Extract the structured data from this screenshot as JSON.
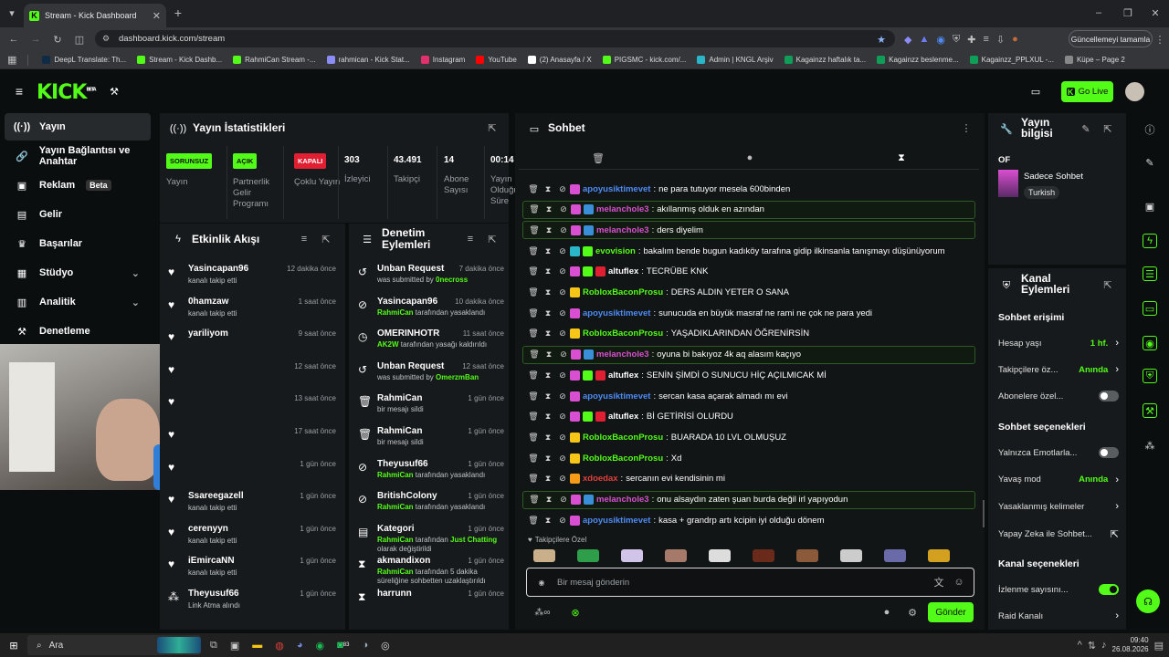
{
  "browser": {
    "tab_title": "Stream - Kick Dashboard",
    "url": "dashboard.kick.com/stream",
    "update_label": "Güncellemeyi tamamla",
    "bookmarks": [
      "DeepL Translate: Th...",
      "Stream - Kick Dashb...",
      "RahmiCan Stream -...",
      "rahmican - Kick Stat...",
      "Instagram",
      "YouTube",
      "(2) Anasayfa / X",
      "PIGSMC - kick.com/...",
      "Admin | KNGL Arşiv",
      "Kagainzz haftalık ta...",
      "Kagainzz beslenme...",
      "Kagainzz_PPLXUL -...",
      "Küpe – Page 2"
    ]
  },
  "app": {
    "logo": "KICK",
    "beta_sup": "BETA",
    "go_live": "Go Live"
  },
  "sidebar": {
    "items": [
      {
        "label": "Yayın",
        "icon": "broadcast-icon"
      },
      {
        "label": "Yayın Bağlantısı ve Anahtar",
        "icon": "link-icon"
      },
      {
        "label": "Reklam",
        "icon": "ad-icon",
        "badge": "Beta"
      },
      {
        "label": "Gelir",
        "icon": "revenue-icon"
      },
      {
        "label": "Başarılar",
        "icon": "trophy-icon"
      },
      {
        "label": "Stüdyo",
        "icon": "studio-icon"
      },
      {
        "label": "Analitik",
        "icon": "analytics-icon"
      },
      {
        "label": "Denetleme",
        "icon": "moderation-icon"
      }
    ]
  },
  "stats": {
    "title": "Yayın İstatistikleri",
    "badges": [
      {
        "text": "SORUNSUZ",
        "label": "Yayın",
        "color": "#53fc18"
      },
      {
        "text": "AÇIK",
        "label": "Partnerlik Gelir Programı",
        "color": "#53fc18"
      },
      {
        "text": "KAPALI",
        "label": "Çoklu Yayın",
        "color": "#e01f32"
      }
    ],
    "numbers": [
      {
        "value": "303",
        "label": "İzleyici"
      },
      {
        "value": "43.491",
        "label": "Takipçi"
      },
      {
        "value": "14",
        "label": "Abone Sayısı"
      },
      {
        "value": "00:14",
        "label": "Yayın Olduğu Süre"
      }
    ]
  },
  "activity": {
    "title": "Etkinlik Akışı",
    "items": [
      {
        "name": "Yasincapan96",
        "sub": "kanalı takip etti",
        "time": "12 dakika önce"
      },
      {
        "name": "0hamzaw",
        "sub": "kanalı takip etti",
        "time": "1 saat önce"
      },
      {
        "name": "yariliyom",
        "sub": "",
        "time": "9 saat önce"
      },
      {
        "name": "",
        "sub": "",
        "time": "12 saat önce"
      },
      {
        "name": "",
        "sub": "",
        "time": "13 saat önce"
      },
      {
        "name": "",
        "sub": "",
        "time": "17 saat önce"
      },
      {
        "name": "",
        "sub": "",
        "time": "1 gün önce"
      },
      {
        "name": "Ssareegazell",
        "sub": "kanalı takip etti",
        "time": "1 gün önce"
      },
      {
        "name": "cerenyyn",
        "sub": "kanalı takip etti",
        "time": "1 gün önce"
      },
      {
        "name": "iEmircaNN",
        "sub": "kanalı takip etti",
        "time": "1 gün önce"
      },
      {
        "name": "Theyusuf66",
        "sub": "Link Atma alındı",
        "time": "1 gün önce"
      }
    ]
  },
  "moderation": {
    "title": "Denetim Eylemleri",
    "items": [
      {
        "name": "Unban Request",
        "pre": "was submitted by ",
        "hl": "0necross",
        "post": "",
        "time": "7 dakika önce",
        "icon": "request-icon"
      },
      {
        "name": "Yasincapan96",
        "pre": "",
        "hl": "RahmiCan",
        "post": " tarafından yasaklandı",
        "time": "10 dakika önce",
        "icon": "ban-icon"
      },
      {
        "name": "OMERINHOTR",
        "pre": "",
        "hl": "AK2W",
        "post": " tarafından yasağı kaldırıldı",
        "time": "11 saat önce",
        "icon": "unban-icon"
      },
      {
        "name": "Unban Request",
        "pre": "was submitted by ",
        "hl": "OmerzmBan",
        "post": "",
        "time": "12 saat önce",
        "icon": "request-icon"
      },
      {
        "name": "RahmiCan",
        "pre": "bir mesajı sildi",
        "hl": "",
        "post": "",
        "time": "1 gün önce",
        "icon": "trash-icon"
      },
      {
        "name": "RahmiCan",
        "pre": "bir mesajı sildi",
        "hl": "",
        "post": "",
        "time": "1 gün önce",
        "icon": "trash-icon"
      },
      {
        "name": "Theyusuf66",
        "pre": "",
        "hl": "RahmiCan",
        "post": " tarafından yasaklandı",
        "time": "1 gün önce",
        "icon": "ban-icon"
      },
      {
        "name": "BritishColony",
        "pre": "",
        "hl": "RahmiCan",
        "post": " tarafından yasaklandı",
        "time": "1 gün önce",
        "icon": "ban-icon"
      },
      {
        "name": "Kategori",
        "pre": "",
        "hl": "RahmiCan",
        "post": " tarafından ",
        "hl2": "Just Chatting",
        "post2": " olarak değiştirildi",
        "time": "1 gün önce",
        "icon": "category-icon"
      },
      {
        "name": "akmandixon",
        "pre": "",
        "hl": "RahmiCan",
        "post": " tarafından 5 dakika süreliğine sohbetten uzaklaştırıldı",
        "time": "1 gün önce",
        "icon": "timeout-icon"
      },
      {
        "name": "harrunn",
        "pre": "",
        "hl": "",
        "post": "",
        "time": "1 gün önce",
        "icon": "timeout-icon"
      }
    ]
  },
  "chat": {
    "title": "Sohbet",
    "placeholder": "Bir mesaj gönderin",
    "send": "Gönder",
    "emote_label": "Takipçilere Özel",
    "messages": [
      {
        "user": "apoyusiktimevet",
        "color": "#4d8bf5",
        "text": "ne para tutuyor mesela 600binden",
        "badges": [
          "#d94fd1"
        ],
        "hl": false
      },
      {
        "user": "melanchole3",
        "color": "#d94fd1",
        "text": "akıllanmış olduk en azından",
        "badges": [
          "#d94fd1",
          "#3a8fd9"
        ],
        "hl": true
      },
      {
        "user": "melanchole3",
        "color": "#d94fd1",
        "text": "ders diyelim",
        "badges": [
          "#d94fd1",
          "#3a8fd9"
        ],
        "hl": true
      },
      {
        "user": "evovision",
        "color": "#53fc18",
        "text": "bakalım bende bugun kadıköy tarafına gidip ilkinsanla tanışmayı düşünüyorum",
        "badges": [
          "#2bb5c9",
          "#53fc18"
        ],
        "hl": false
      },
      {
        "user": "altuflex",
        "color": "#ffffff",
        "text": "TECRÜBE KNK",
        "badges": [
          "#d94fd1",
          "#53fc18",
          "#e01f32"
        ],
        "hl": false
      },
      {
        "user": "RobloxBaconProsu",
        "color": "#53fc18",
        "text": "DERS ALDIN YETER O SANA",
        "badges": [
          "#f5c518"
        ],
        "hl": false
      },
      {
        "user": "apoyusiktimevet",
        "color": "#4d8bf5",
        "text": "sunucuda en büyük masraf ne rami ne çok ne para yedi",
        "badges": [
          "#d94fd1"
        ],
        "hl": false
      },
      {
        "user": "RobloxBaconProsu",
        "color": "#53fc18",
        "text": "YAŞADIKLARINDAN ÖĞRENİRSİN",
        "badges": [
          "#f5c518"
        ],
        "hl": false
      },
      {
        "user": "melanchole3",
        "color": "#d94fd1",
        "text": "oyuna bi bakıyoz 4k aq alasım kaçıyo",
        "badges": [
          "#d94fd1",
          "#3a8fd9"
        ],
        "hl": true
      },
      {
        "user": "altuflex",
        "color": "#ffffff",
        "text": "SENİN ŞİMDİ O SUNUCU HİÇ AÇILMICAK Mİ",
        "badges": [
          "#d94fd1",
          "#53fc18",
          "#e01f32"
        ],
        "hl": false
      },
      {
        "user": "apoyusiktimevet",
        "color": "#4d8bf5",
        "text": "sercan kasa açarak almadı mı evi",
        "badges": [
          "#d94fd1"
        ],
        "hl": false
      },
      {
        "user": "altuflex",
        "color": "#ffffff",
        "text": "Bİ GETİRİSİ OLURDU",
        "badges": [
          "#d94fd1",
          "#53fc18",
          "#e01f32"
        ],
        "hl": false
      },
      {
        "user": "RobloxBaconProsu",
        "color": "#53fc18",
        "text": "BUARADA 10 LVL OLMUŞUZ",
        "badges": [
          "#f5c518"
        ],
        "hl": false
      },
      {
        "user": "RobloxBaconProsu",
        "color": "#53fc18",
        "text": "Xd",
        "badges": [
          "#f5c518"
        ],
        "hl": false
      },
      {
        "user": "xdoedax",
        "color": "#e0403a",
        "text": "sercanın evi kendisinin mi",
        "badges": [
          "#f59b18"
        ],
        "hl": false
      },
      {
        "user": "melanchole3",
        "color": "#d94fd1",
        "text": "onu alsaydın zaten şuan burda değil irl yapıyodun",
        "badges": [
          "#d94fd1",
          "#3a8fd9"
        ],
        "hl": true
      },
      {
        "user": "apoyusiktimevet",
        "color": "#4d8bf5",
        "text": "kasa + grandrp artı kcipin iyi olduğu dönem",
        "badges": [
          "#d94fd1"
        ],
        "hl": false
      }
    ]
  },
  "info": {
    "title": "Yayın bilgisi",
    "of": "OF",
    "category": "Sadece Sohbet",
    "tag": "Turkish"
  },
  "channel": {
    "title": "Kanal Eylemleri",
    "chat_access": "Sohbet erişimi",
    "rows1": [
      {
        "label": "Hesap yaşı",
        "value": "1 hf.",
        "type": "link"
      },
      {
        "label": "Takipçilere öz...",
        "value": "Anında",
        "type": "link"
      },
      {
        "label": "Abonelere özel...",
        "value": "",
        "type": "toggle",
        "on": false
      }
    ],
    "chat_options": "Sohbet seçenekleri",
    "rows2": [
      {
        "label": "Yalnızca Emotlarla...",
        "type": "toggle",
        "on": false
      },
      {
        "label": "Yavaş mod",
        "value": "Anında",
        "type": "link"
      },
      {
        "label": "Yasaklanmış kelimeler",
        "value": "",
        "type": "link"
      },
      {
        "label": "Yapay Zeka ile Sohbet...",
        "value": "",
        "type": "ext"
      }
    ],
    "channel_options": "Kanal seçenekleri",
    "rows3": [
      {
        "label": "İzlenme sayısını...",
        "type": "toggle",
        "on": true
      },
      {
        "label": "Raid Kanalı",
        "type": "link",
        "value": ""
      }
    ]
  },
  "taskbar": {
    "search": "Ara",
    "time": "09:40",
    "date": "26.08.2026",
    "badge": "83"
  }
}
